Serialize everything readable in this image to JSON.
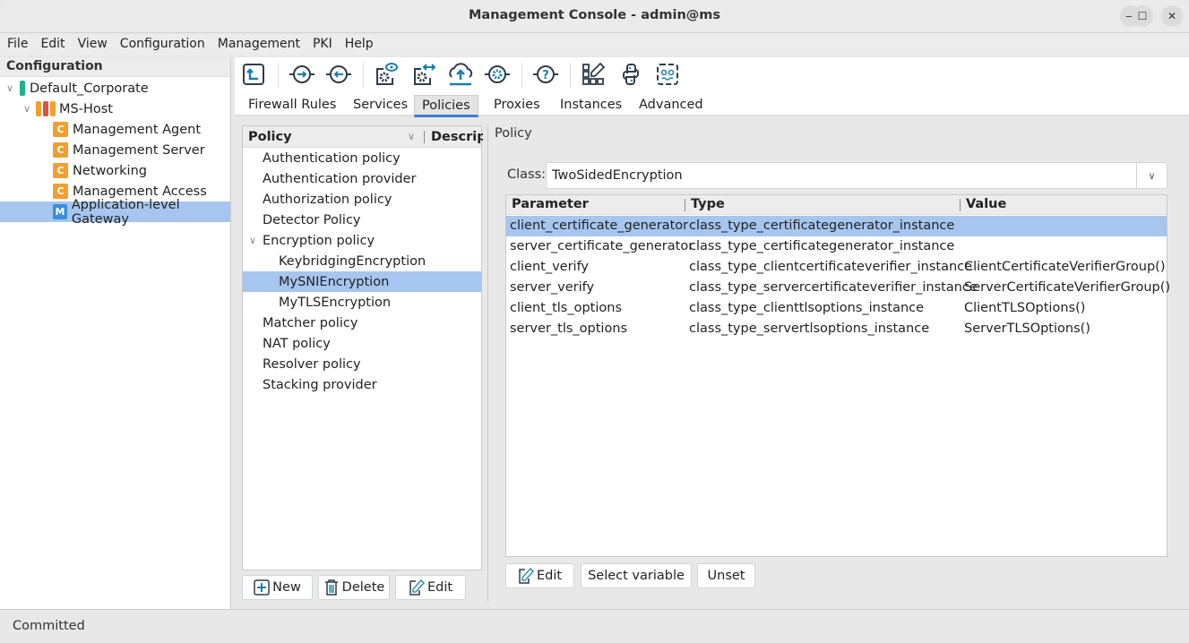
{
  "window": {
    "title": "Management Console - admin@ms",
    "controls": [
      "minimize",
      "maximize",
      "close"
    ]
  },
  "menubar": [
    "File",
    "Edit",
    "View",
    "Configuration",
    "Management",
    "PKI",
    "Help"
  ],
  "left_panel": {
    "header": "Configuration",
    "tree": [
      {
        "label": "Default_Corporate",
        "level": 0,
        "expanded": true,
        "icon": "site-bar-icon"
      },
      {
        "label": "MS-Host",
        "level": 1,
        "expanded": true,
        "icon": "host-bars-icon"
      },
      {
        "label": "Management Agent",
        "level": 2,
        "badge": "C"
      },
      {
        "label": "Management Server",
        "level": 2,
        "badge": "C"
      },
      {
        "label": "Networking",
        "level": 2,
        "badge": "C"
      },
      {
        "label": "Management Access",
        "level": 2,
        "badge": "C"
      },
      {
        "label": "Application-level Gateway",
        "level": 2,
        "badge": "M",
        "selected": true
      }
    ]
  },
  "toolbar": {
    "icons": [
      "upload-config-icon",
      "connect-icon",
      "disconnect-icon",
      "view-config-icon",
      "compare-config-icon",
      "cloud-upload-icon",
      "settings-node-icon",
      "help-icon",
      "edit-grid-icon",
      "python-icon",
      "text-editor-icon"
    ]
  },
  "tabs": [
    "Firewall Rules",
    "Services",
    "Policies",
    "Proxies",
    "Instances",
    "Advanced"
  ],
  "active_tab": "Policies",
  "policy_list": {
    "columns": [
      "Policy",
      "Descript"
    ],
    "items": [
      {
        "label": "Authentication policy",
        "level": 0
      },
      {
        "label": "Authentication provider",
        "level": 0
      },
      {
        "label": "Authorization policy",
        "level": 0
      },
      {
        "label": "Detector Policy",
        "level": 0
      },
      {
        "label": "Encryption policy",
        "level": 0,
        "expanded": true
      },
      {
        "label": "KeybridgingEncryption",
        "level": 1
      },
      {
        "label": "MySNIEncryption",
        "level": 1,
        "selected": true
      },
      {
        "label": "MyTLSEncryption",
        "level": 1
      },
      {
        "label": "Matcher policy",
        "level": 0
      },
      {
        "label": "NAT policy",
        "level": 0
      },
      {
        "label": "Resolver policy",
        "level": 0
      },
      {
        "label": "Stacking provider",
        "level": 0
      }
    ],
    "buttons": {
      "new": "New",
      "delete": "Delete",
      "edit": "Edit"
    }
  },
  "detail": {
    "section_title": "Policy",
    "class_label": "Class:",
    "class_value": "TwoSidedEncryption",
    "table": {
      "columns": [
        "Parameter",
        "Type",
        "Value"
      ],
      "rows": [
        {
          "parameter": "client_certificate_generator",
          "type": "class_type_certificategenerator_instance",
          "value": "",
          "selected": true
        },
        {
          "parameter": "server_certificate_generator",
          "type": "class_type_certificategenerator_instance",
          "value": ""
        },
        {
          "parameter": "client_verify",
          "type": "class_type_clientcertificateverifier_instance",
          "value": "ClientCertificateVerifierGroup()"
        },
        {
          "parameter": "server_verify",
          "type": "class_type_servercertificateverifier_instance",
          "value": "ServerCertificateVerifierGroup()"
        },
        {
          "parameter": "client_tls_options",
          "type": "class_type_clienttlsoptions_instance",
          "value": "ClientTLSOptions()"
        },
        {
          "parameter": "server_tls_options",
          "type": "class_type_servertlsoptions_instance",
          "value": "ServerTLSOptions()"
        }
      ]
    },
    "buttons": {
      "edit": "Edit",
      "select_variable": "Select variable",
      "unset": "Unset"
    }
  },
  "statusbar": {
    "text": "Committed"
  },
  "colors": {
    "selection": "#a6c6ef",
    "accent": "#3b7fd1",
    "badge_c": "#f0a030",
    "badge_m": "#3a8fd8",
    "icon_teal": "#1a7fa8",
    "site_green": "#1db386",
    "host_orange": "#f0a030",
    "host_red": "#e05040"
  }
}
